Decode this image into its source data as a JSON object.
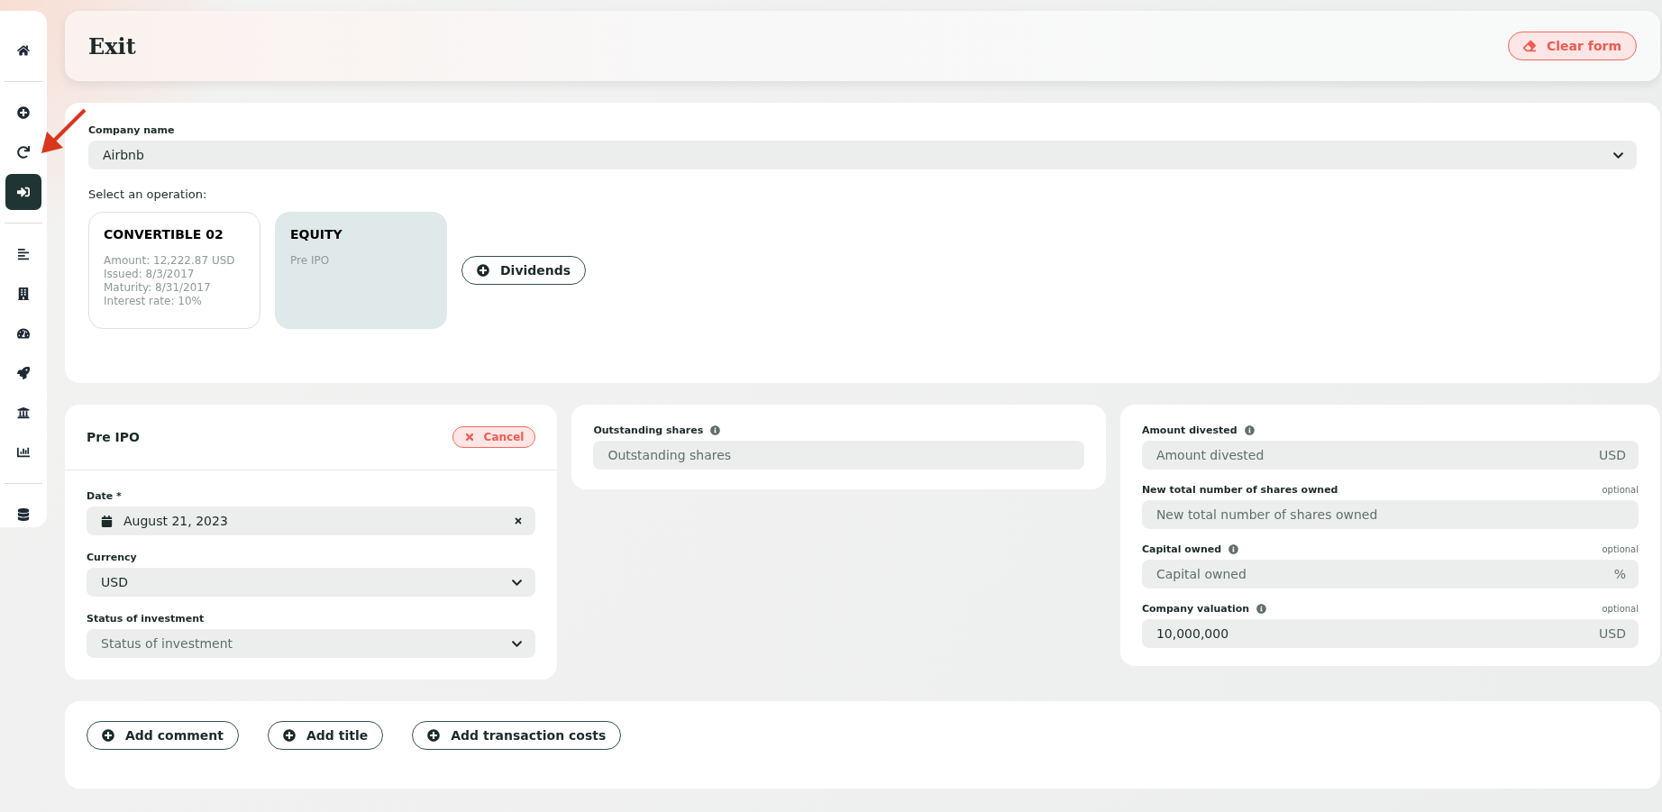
{
  "sidebar": {
    "groups": [
      {
        "items": [
          {
            "selected": false
          }
        ]
      },
      {
        "items": [
          {
            "selected": false
          },
          {
            "selected": false
          },
          {
            "selected": true
          }
        ]
      },
      {
        "items": [
          {
            "selected": false
          },
          {
            "selected": false
          },
          {
            "selected": false
          },
          {
            "selected": false
          },
          {
            "selected": false
          },
          {
            "selected": false
          }
        ]
      },
      {
        "items": [
          {
            "selected": false
          }
        ]
      }
    ]
  },
  "header": {
    "title": "Exit",
    "clear_button": "Clear form"
  },
  "company": {
    "label": "Company name",
    "value": "Airbnb",
    "operation_prompt": "Select an operation:",
    "operations": [
      {
        "title": "CONVERTIBLE 02",
        "selected": false,
        "details": [
          "Amount: 12,222.87 USD",
          "Issued: 8/3/2017",
          "Maturity: 8/31/2017",
          "Interest rate: 10%"
        ]
      },
      {
        "title": "EQUITY",
        "selected": true,
        "details": [
          "Pre IPO"
        ]
      }
    ],
    "dividends_button": "Dividends"
  },
  "operation_panel": {
    "title": "Pre IPO",
    "cancel_button": "Cancel",
    "fields": [
      {
        "kind": "date",
        "label": "Date *",
        "value": "August 21, 2023"
      },
      {
        "kind": "select",
        "label": "Currency",
        "value": "USD"
      },
      {
        "kind": "select",
        "label": "Status of investment",
        "placeholder": "Status of investment"
      }
    ]
  },
  "shares_panel": {
    "fields": [
      {
        "label": "Outstanding shares",
        "info": true,
        "placeholder": "Outstanding shares"
      }
    ]
  },
  "valuation_panel": {
    "fields": [
      {
        "label": "Amount divested",
        "info": true,
        "placeholder": "Amount divested",
        "unit": "USD"
      },
      {
        "label": "New total number of shares owned",
        "info": false,
        "optional": "optional",
        "placeholder": "New total number of shares owned"
      },
      {
        "label": "Capital owned",
        "info": true,
        "optional": "optional",
        "placeholder": "Capital owned",
        "unit": "%"
      },
      {
        "label": "Company valuation",
        "info": true,
        "optional": "optional",
        "value": "10,000,000",
        "unit": "USD"
      }
    ]
  },
  "extras": {
    "buttons": [
      "Add comment",
      "Add title",
      "Add transaction costs"
    ]
  }
}
